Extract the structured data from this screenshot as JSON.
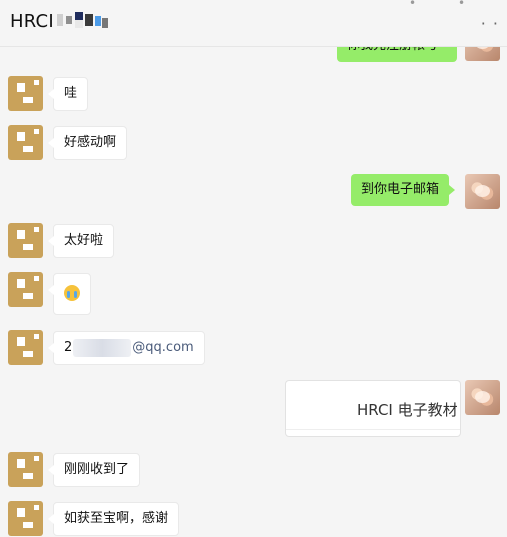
{
  "header": {
    "title": "HRCI",
    "more_label": "· ·"
  },
  "messages": [
    {
      "side": "right",
      "type": "text",
      "text": "你我先注册帐号"
    },
    {
      "side": "left",
      "type": "text",
      "text": "哇"
    },
    {
      "side": "left",
      "type": "text",
      "text": "好感动啊"
    },
    {
      "side": "right",
      "type": "text",
      "text": "到你电子邮箱"
    },
    {
      "side": "left",
      "type": "text",
      "text": "太好啦"
    },
    {
      "side": "left",
      "type": "emoji",
      "emoji": "crying-face"
    },
    {
      "side": "left",
      "type": "email",
      "prefix": "2",
      "suffix": "@qq.com"
    },
    {
      "side": "right",
      "type": "file",
      "title": "HRCI 电子教材"
    },
    {
      "side": "left",
      "type": "text",
      "text": "刚刚收到了"
    },
    {
      "side": "left",
      "type": "text",
      "text": "如获至宝啊，感谢"
    }
  ],
  "colors": {
    "right_bubble": "#95ec69",
    "left_bubble": "#ffffff",
    "background": "#f5f5f5"
  }
}
